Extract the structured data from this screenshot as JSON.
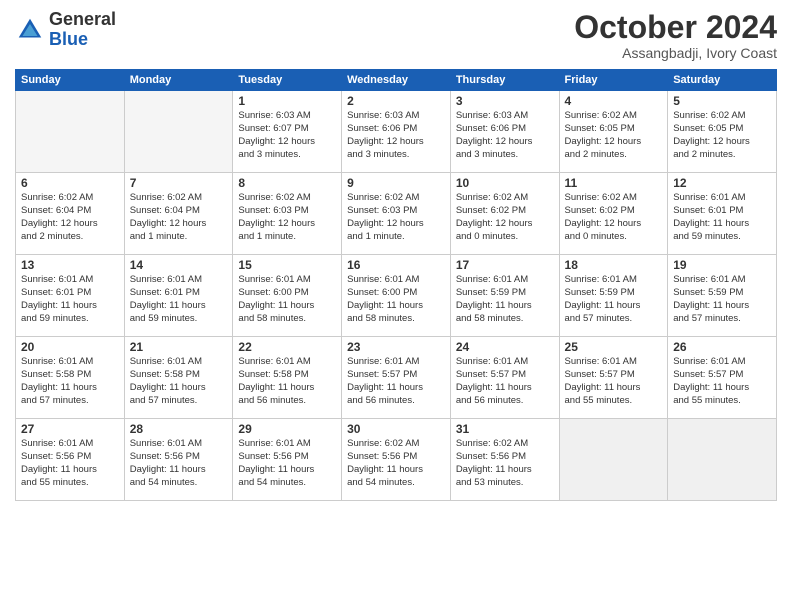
{
  "header": {
    "logo_general": "General",
    "logo_blue": "Blue",
    "month_title": "October 2024",
    "location": "Assangbadji, Ivory Coast"
  },
  "weekdays": [
    "Sunday",
    "Monday",
    "Tuesday",
    "Wednesday",
    "Thursday",
    "Friday",
    "Saturday"
  ],
  "weeks": [
    [
      {
        "day": "",
        "empty": true
      },
      {
        "day": "",
        "empty": true
      },
      {
        "day": "1",
        "l1": "Sunrise: 6:03 AM",
        "l2": "Sunset: 6:07 PM",
        "l3": "Daylight: 12 hours",
        "l4": "and 3 minutes."
      },
      {
        "day": "2",
        "l1": "Sunrise: 6:03 AM",
        "l2": "Sunset: 6:06 PM",
        "l3": "Daylight: 12 hours",
        "l4": "and 3 minutes."
      },
      {
        "day": "3",
        "l1": "Sunrise: 6:03 AM",
        "l2": "Sunset: 6:06 PM",
        "l3": "Daylight: 12 hours",
        "l4": "and 3 minutes."
      },
      {
        "day": "4",
        "l1": "Sunrise: 6:02 AM",
        "l2": "Sunset: 6:05 PM",
        "l3": "Daylight: 12 hours",
        "l4": "and 2 minutes."
      },
      {
        "day": "5",
        "l1": "Sunrise: 6:02 AM",
        "l2": "Sunset: 6:05 PM",
        "l3": "Daylight: 12 hours",
        "l4": "and 2 minutes."
      }
    ],
    [
      {
        "day": "6",
        "l1": "Sunrise: 6:02 AM",
        "l2": "Sunset: 6:04 PM",
        "l3": "Daylight: 12 hours",
        "l4": "and 2 minutes."
      },
      {
        "day": "7",
        "l1": "Sunrise: 6:02 AM",
        "l2": "Sunset: 6:04 PM",
        "l3": "Daylight: 12 hours",
        "l4": "and 1 minute."
      },
      {
        "day": "8",
        "l1": "Sunrise: 6:02 AM",
        "l2": "Sunset: 6:03 PM",
        "l3": "Daylight: 12 hours",
        "l4": "and 1 minute."
      },
      {
        "day": "9",
        "l1": "Sunrise: 6:02 AM",
        "l2": "Sunset: 6:03 PM",
        "l3": "Daylight: 12 hours",
        "l4": "and 1 minute."
      },
      {
        "day": "10",
        "l1": "Sunrise: 6:02 AM",
        "l2": "Sunset: 6:02 PM",
        "l3": "Daylight: 12 hours",
        "l4": "and 0 minutes."
      },
      {
        "day": "11",
        "l1": "Sunrise: 6:02 AM",
        "l2": "Sunset: 6:02 PM",
        "l3": "Daylight: 12 hours",
        "l4": "and 0 minutes."
      },
      {
        "day": "12",
        "l1": "Sunrise: 6:01 AM",
        "l2": "Sunset: 6:01 PM",
        "l3": "Daylight: 11 hours",
        "l4": "and 59 minutes."
      }
    ],
    [
      {
        "day": "13",
        "l1": "Sunrise: 6:01 AM",
        "l2": "Sunset: 6:01 PM",
        "l3": "Daylight: 11 hours",
        "l4": "and 59 minutes."
      },
      {
        "day": "14",
        "l1": "Sunrise: 6:01 AM",
        "l2": "Sunset: 6:01 PM",
        "l3": "Daylight: 11 hours",
        "l4": "and 59 minutes."
      },
      {
        "day": "15",
        "l1": "Sunrise: 6:01 AM",
        "l2": "Sunset: 6:00 PM",
        "l3": "Daylight: 11 hours",
        "l4": "and 58 minutes."
      },
      {
        "day": "16",
        "l1": "Sunrise: 6:01 AM",
        "l2": "Sunset: 6:00 PM",
        "l3": "Daylight: 11 hours",
        "l4": "and 58 minutes."
      },
      {
        "day": "17",
        "l1": "Sunrise: 6:01 AM",
        "l2": "Sunset: 5:59 PM",
        "l3": "Daylight: 11 hours",
        "l4": "and 58 minutes."
      },
      {
        "day": "18",
        "l1": "Sunrise: 6:01 AM",
        "l2": "Sunset: 5:59 PM",
        "l3": "Daylight: 11 hours",
        "l4": "and 57 minutes."
      },
      {
        "day": "19",
        "l1": "Sunrise: 6:01 AM",
        "l2": "Sunset: 5:59 PM",
        "l3": "Daylight: 11 hours",
        "l4": "and 57 minutes."
      }
    ],
    [
      {
        "day": "20",
        "l1": "Sunrise: 6:01 AM",
        "l2": "Sunset: 5:58 PM",
        "l3": "Daylight: 11 hours",
        "l4": "and 57 minutes."
      },
      {
        "day": "21",
        "l1": "Sunrise: 6:01 AM",
        "l2": "Sunset: 5:58 PM",
        "l3": "Daylight: 11 hours",
        "l4": "and 57 minutes."
      },
      {
        "day": "22",
        "l1": "Sunrise: 6:01 AM",
        "l2": "Sunset: 5:58 PM",
        "l3": "Daylight: 11 hours",
        "l4": "and 56 minutes."
      },
      {
        "day": "23",
        "l1": "Sunrise: 6:01 AM",
        "l2": "Sunset: 5:57 PM",
        "l3": "Daylight: 11 hours",
        "l4": "and 56 minutes."
      },
      {
        "day": "24",
        "l1": "Sunrise: 6:01 AM",
        "l2": "Sunset: 5:57 PM",
        "l3": "Daylight: 11 hours",
        "l4": "and 56 minutes."
      },
      {
        "day": "25",
        "l1": "Sunrise: 6:01 AM",
        "l2": "Sunset: 5:57 PM",
        "l3": "Daylight: 11 hours",
        "l4": "and 55 minutes."
      },
      {
        "day": "26",
        "l1": "Sunrise: 6:01 AM",
        "l2": "Sunset: 5:57 PM",
        "l3": "Daylight: 11 hours",
        "l4": "and 55 minutes."
      }
    ],
    [
      {
        "day": "27",
        "l1": "Sunrise: 6:01 AM",
        "l2": "Sunset: 5:56 PM",
        "l3": "Daylight: 11 hours",
        "l4": "and 55 minutes."
      },
      {
        "day": "28",
        "l1": "Sunrise: 6:01 AM",
        "l2": "Sunset: 5:56 PM",
        "l3": "Daylight: 11 hours",
        "l4": "and 54 minutes."
      },
      {
        "day": "29",
        "l1": "Sunrise: 6:01 AM",
        "l2": "Sunset: 5:56 PM",
        "l3": "Daylight: 11 hours",
        "l4": "and 54 minutes."
      },
      {
        "day": "30",
        "l1": "Sunrise: 6:02 AM",
        "l2": "Sunset: 5:56 PM",
        "l3": "Daylight: 11 hours",
        "l4": "and 54 minutes."
      },
      {
        "day": "31",
        "l1": "Sunrise: 6:02 AM",
        "l2": "Sunset: 5:56 PM",
        "l3": "Daylight: 11 hours",
        "l4": "and 53 minutes."
      },
      {
        "day": "",
        "empty": true,
        "shaded": true
      },
      {
        "day": "",
        "empty": true,
        "shaded": true
      }
    ]
  ]
}
